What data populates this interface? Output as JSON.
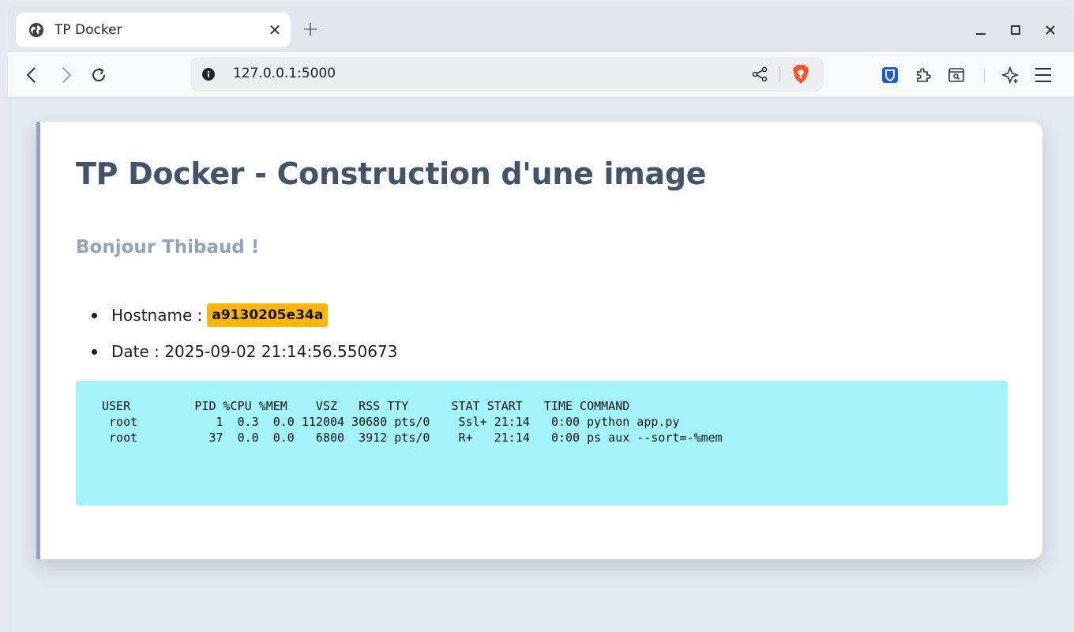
{
  "browser": {
    "tab": {
      "title": "TP Docker"
    },
    "url": "127.0.0.1:5000"
  },
  "page": {
    "title": "TP Docker - Construction d'une image",
    "greeting": "Bonjour Thibaud !",
    "hostname_label": "Hostname :",
    "hostname_value": "a9130205e34a",
    "date_text": "Date : 2025-09-02 21:14:56.550673",
    "ps_output": [
      "USER         PID %CPU %MEM    VSZ   RSS TTY      STAT START   TIME COMMAND",
      " root           1  0.3  0.0 112004 30680 pts/0    Ssl+ 21:14   0:00 python app.py",
      " root          37  0.0  0.0   6800  3912 pts/0    R+   21:14   0:00 ps aux --sort=-%mem"
    ]
  },
  "colors": {
    "accent_border": "#94a3b8",
    "badge": "#ffb703",
    "terminal_bg": "#a3f3fb",
    "title": "#44536a"
  }
}
